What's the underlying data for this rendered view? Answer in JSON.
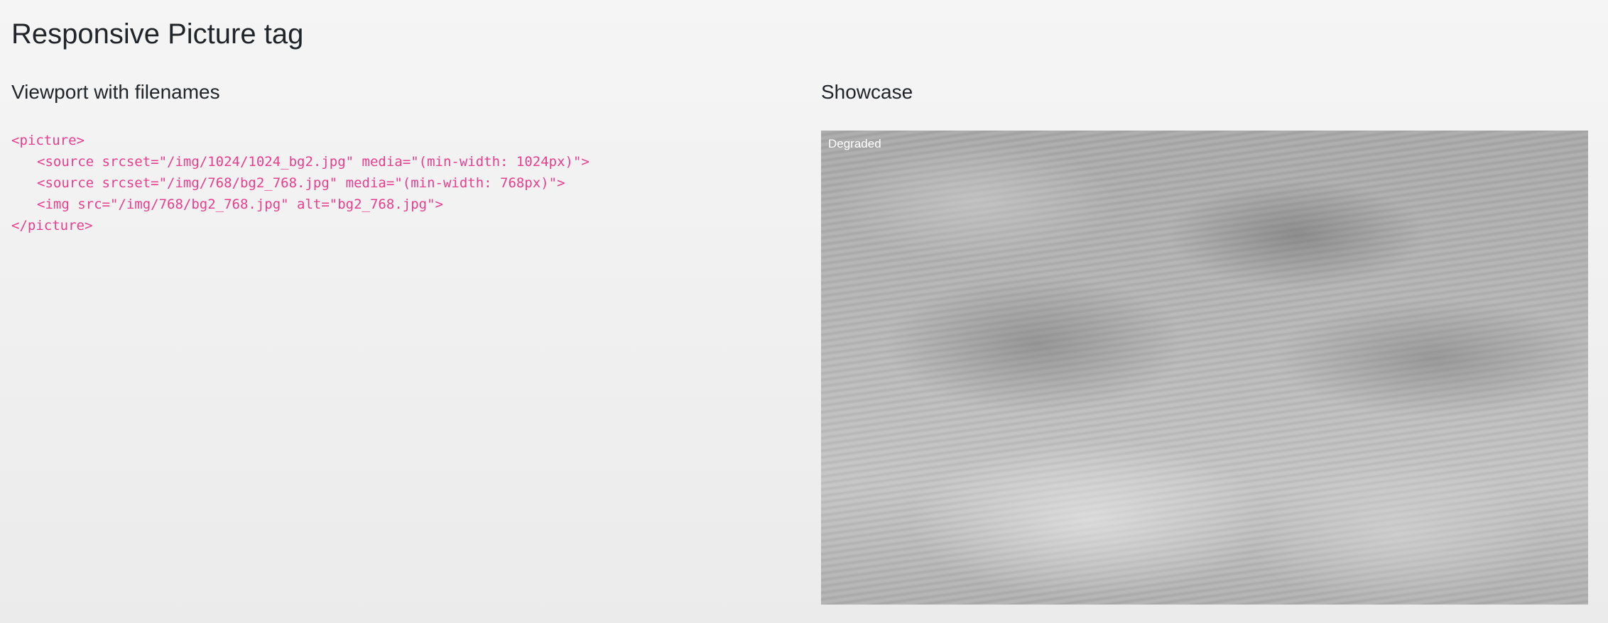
{
  "page": {
    "title": "Responsive Picture tag"
  },
  "left_section": {
    "heading": "Viewport with filenames",
    "code_lines": [
      "<picture>",
      "<source srcset=\"/img/1024/1024_bg2.jpg\" media=\"(min-width: 1024px)\">",
      "<source srcset=\"/img/768/bg2_768.jpg\" media=\"(min-width: 768px)\">",
      "<img src=\"/img/768/bg2_768.jpg\" alt=\"bg2_768.jpg\">",
      "</picture>"
    ]
  },
  "right_section": {
    "heading": "Showcase",
    "image_badge": "Degraded"
  },
  "colors": {
    "code": "#e83e8c",
    "text": "#212529"
  }
}
